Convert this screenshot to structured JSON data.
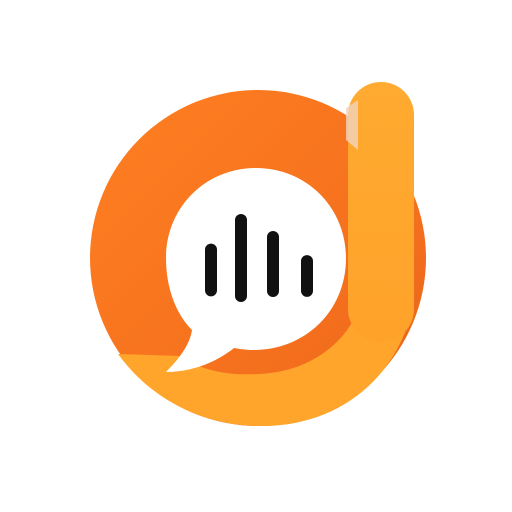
{
  "app_icon": {
    "icon_name": "audio-d-logo-icon",
    "colors": {
      "background": "#ffffff",
      "ring_orange": "#ff7a1f",
      "ring_orange_dark": "#e8651a",
      "stem_yellow": "#ffa82e",
      "bubble": "#ffffff",
      "bars": "#111111"
    },
    "equalizer_bars": [
      0.48,
      0.8,
      0.6,
      0.38
    ]
  }
}
